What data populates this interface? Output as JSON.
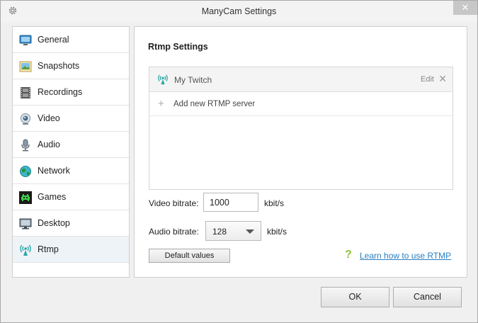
{
  "window": {
    "title": "ManyCam Settings",
    "close_glyph": "✕",
    "title_icon": "gear-icon"
  },
  "sidebar": {
    "items": [
      {
        "label": "General",
        "icon": "monitor-icon",
        "active": false
      },
      {
        "label": "Snapshots",
        "icon": "snapshot-icon",
        "active": false
      },
      {
        "label": "Recordings",
        "icon": "film-icon",
        "active": false
      },
      {
        "label": "Video",
        "icon": "webcam-icon",
        "active": false
      },
      {
        "label": "Audio",
        "icon": "microphone-icon",
        "active": false
      },
      {
        "label": "Network",
        "icon": "globe-icon",
        "active": false
      },
      {
        "label": "Games",
        "icon": "space-invader-icon",
        "active": false
      },
      {
        "label": "Desktop",
        "icon": "desktop-icon",
        "active": false
      },
      {
        "label": "Rtmp",
        "icon": "broadcast-icon",
        "active": true
      }
    ]
  },
  "panel": {
    "title": "Rtmp Settings",
    "servers": [
      {
        "name": "My Twitch",
        "edit_label": "Edit",
        "remove_glyph": "✕"
      }
    ],
    "add_server_label": "Add new RTMP server",
    "add_glyph": "+",
    "video_bitrate": {
      "label": "Video bitrate:",
      "value": "1000",
      "unit": "kbit/s"
    },
    "audio_bitrate": {
      "label": "Audio bitrate:",
      "value": "128",
      "unit": "kbit/s"
    },
    "default_values_label": "Default values",
    "help_glyph": "?",
    "help_link_label": "Learn how to use RTMP"
  },
  "footer": {
    "ok_label": "OK",
    "cancel_label": "Cancel"
  },
  "colors": {
    "accent_link": "#2a7fc0",
    "help_green": "#8cc63f",
    "active_item_bg": "#eef3f8",
    "icon_teal": "#2aa6a6"
  }
}
